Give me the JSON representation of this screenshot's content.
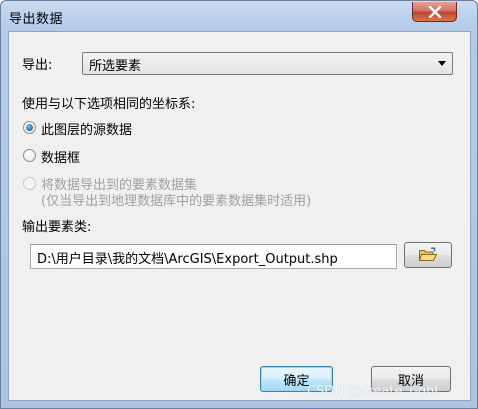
{
  "window": {
    "title": "导出数据"
  },
  "export_row": {
    "label": "导出:",
    "selected_option": "所选要素"
  },
  "coordinate_section": {
    "heading": "使用与以下选项相同的坐标系:",
    "options": [
      {
        "label": "此图层的源数据",
        "checked": true,
        "enabled": true
      },
      {
        "label": "数据框",
        "checked": false,
        "enabled": true
      },
      {
        "label": "将数据导出到的要素数据集",
        "sublabel": "(仅当导出到地理数据库中的要素数据集时适用)",
        "checked": false,
        "enabled": false
      }
    ]
  },
  "output_section": {
    "label": "输出要素类:",
    "path_value": "D:\\用户目录\\我的文档\\ArcGIS\\Export_Output.shp"
  },
  "buttons": {
    "ok_label": "确定",
    "cancel_label": "取消"
  },
  "watermark": "CSDN @create_right",
  "icons": {
    "close": "close-icon",
    "dropdown": "chevron-down-icon",
    "browse": "open-folder-icon"
  },
  "colors": {
    "titlebar": "#b9cfea",
    "close_button": "#c7503a",
    "client_bg": "#f0f0f0",
    "default_button": "#bee6fd"
  }
}
